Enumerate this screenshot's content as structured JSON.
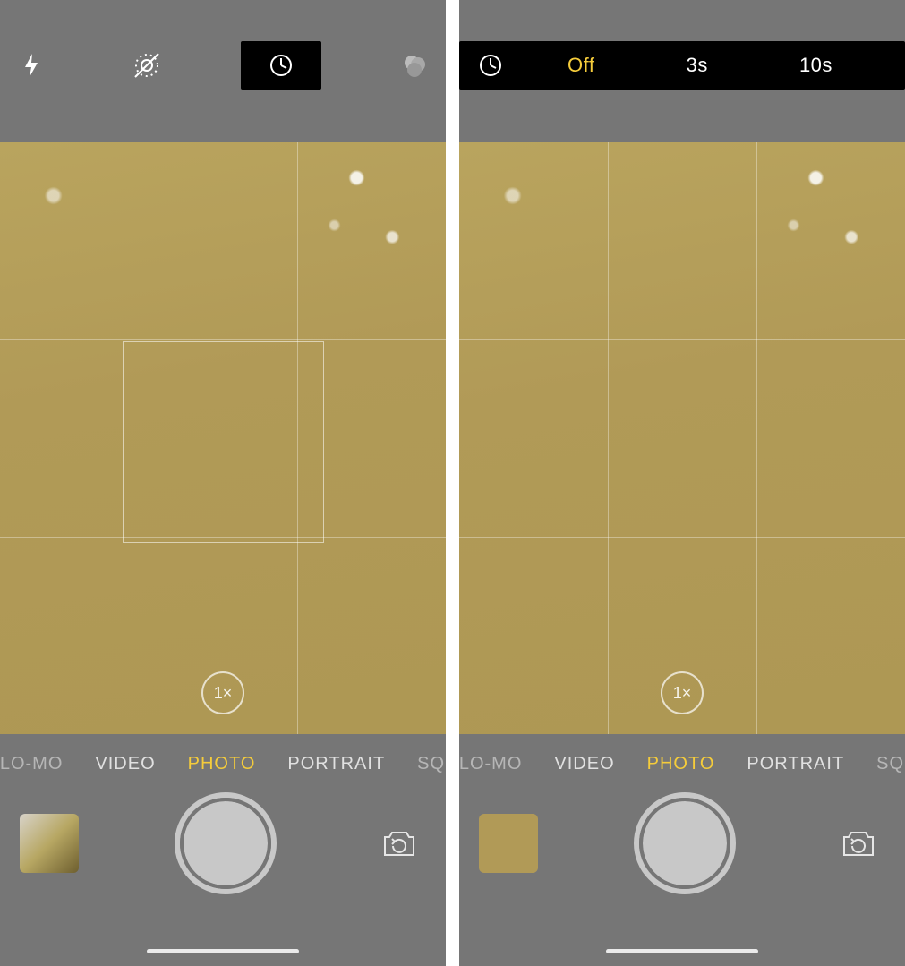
{
  "colors": {
    "accent": "#f5cc3b"
  },
  "left_screen": {
    "top_icons": {
      "flash": "flash-icon",
      "live_photo": "live-photo-off-icon",
      "timer": "timer-icon",
      "filters": "filters-icon"
    },
    "zoom_label": "1×",
    "modes": [
      {
        "label": "SLO-MO",
        "active": false,
        "edge": true
      },
      {
        "label": "VIDEO",
        "active": false,
        "edge": false
      },
      {
        "label": "PHOTO",
        "active": true,
        "edge": false
      },
      {
        "label": "PORTRAIT",
        "active": false,
        "edge": false
      },
      {
        "label": "SQU",
        "active": false,
        "edge": true
      }
    ],
    "show_focus_box": true,
    "thumbnail_style": "photo"
  },
  "right_screen": {
    "timer_options": [
      {
        "label": "Off",
        "selected": true
      },
      {
        "label": "3s",
        "selected": false
      },
      {
        "label": "10s",
        "selected": false
      }
    ],
    "zoom_label": "1×",
    "modes": [
      {
        "label": "SLO-MO",
        "active": false,
        "edge": true
      },
      {
        "label": "VIDEO",
        "active": false,
        "edge": false
      },
      {
        "label": "PHOTO",
        "active": true,
        "edge": false
      },
      {
        "label": "PORTRAIT",
        "active": false,
        "edge": false
      },
      {
        "label": "SQU",
        "active": false,
        "edge": true
      }
    ],
    "show_focus_box": false,
    "thumbnail_style": "plain"
  }
}
